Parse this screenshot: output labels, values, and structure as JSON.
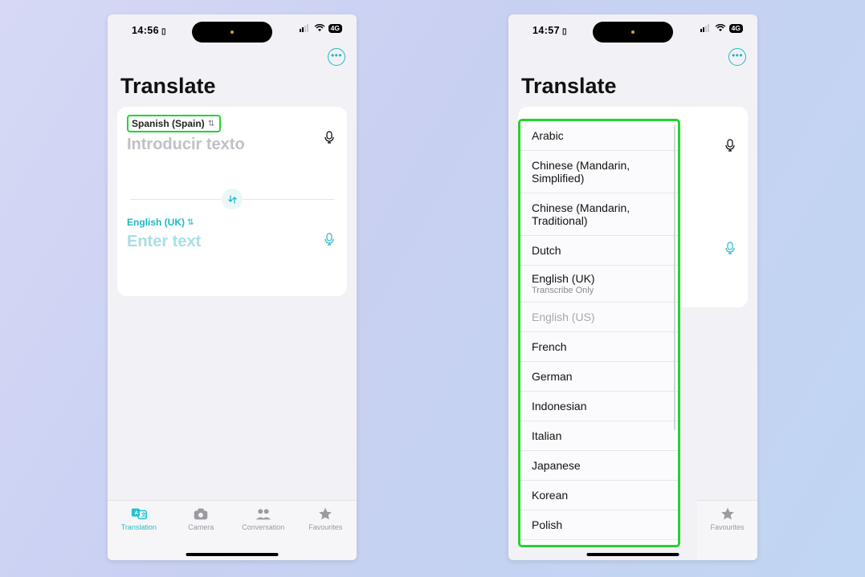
{
  "left": {
    "status": {
      "time": "14:56",
      "net": "4G"
    },
    "title": "Translate",
    "source": {
      "lang": "Spanish (Spain)",
      "placeholder": "Introducir texto"
    },
    "target": {
      "lang": "English (UK)",
      "placeholder": "Enter text"
    },
    "tabs": [
      {
        "label": "Translation",
        "active": true
      },
      {
        "label": "Camera",
        "active": false
      },
      {
        "label": "Conversation",
        "active": false
      },
      {
        "label": "Favourites",
        "active": false
      }
    ]
  },
  "right": {
    "status": {
      "time": "14:57",
      "net": "4G"
    },
    "title": "Translate",
    "languages": [
      {
        "name": "Arabic"
      },
      {
        "name": "Chinese (Mandarin, Simplified)"
      },
      {
        "name": "Chinese (Mandarin, Traditional)"
      },
      {
        "name": "Dutch"
      },
      {
        "name": "English (UK)",
        "sub": "Transcribe Only"
      },
      {
        "name": "English (US)",
        "dim": true
      },
      {
        "name": "French"
      },
      {
        "name": "German"
      },
      {
        "name": "Indonesian"
      },
      {
        "name": "Italian"
      },
      {
        "name": "Japanese"
      },
      {
        "name": "Korean"
      },
      {
        "name": "Polish"
      }
    ],
    "fav_tab": "Favourites"
  }
}
